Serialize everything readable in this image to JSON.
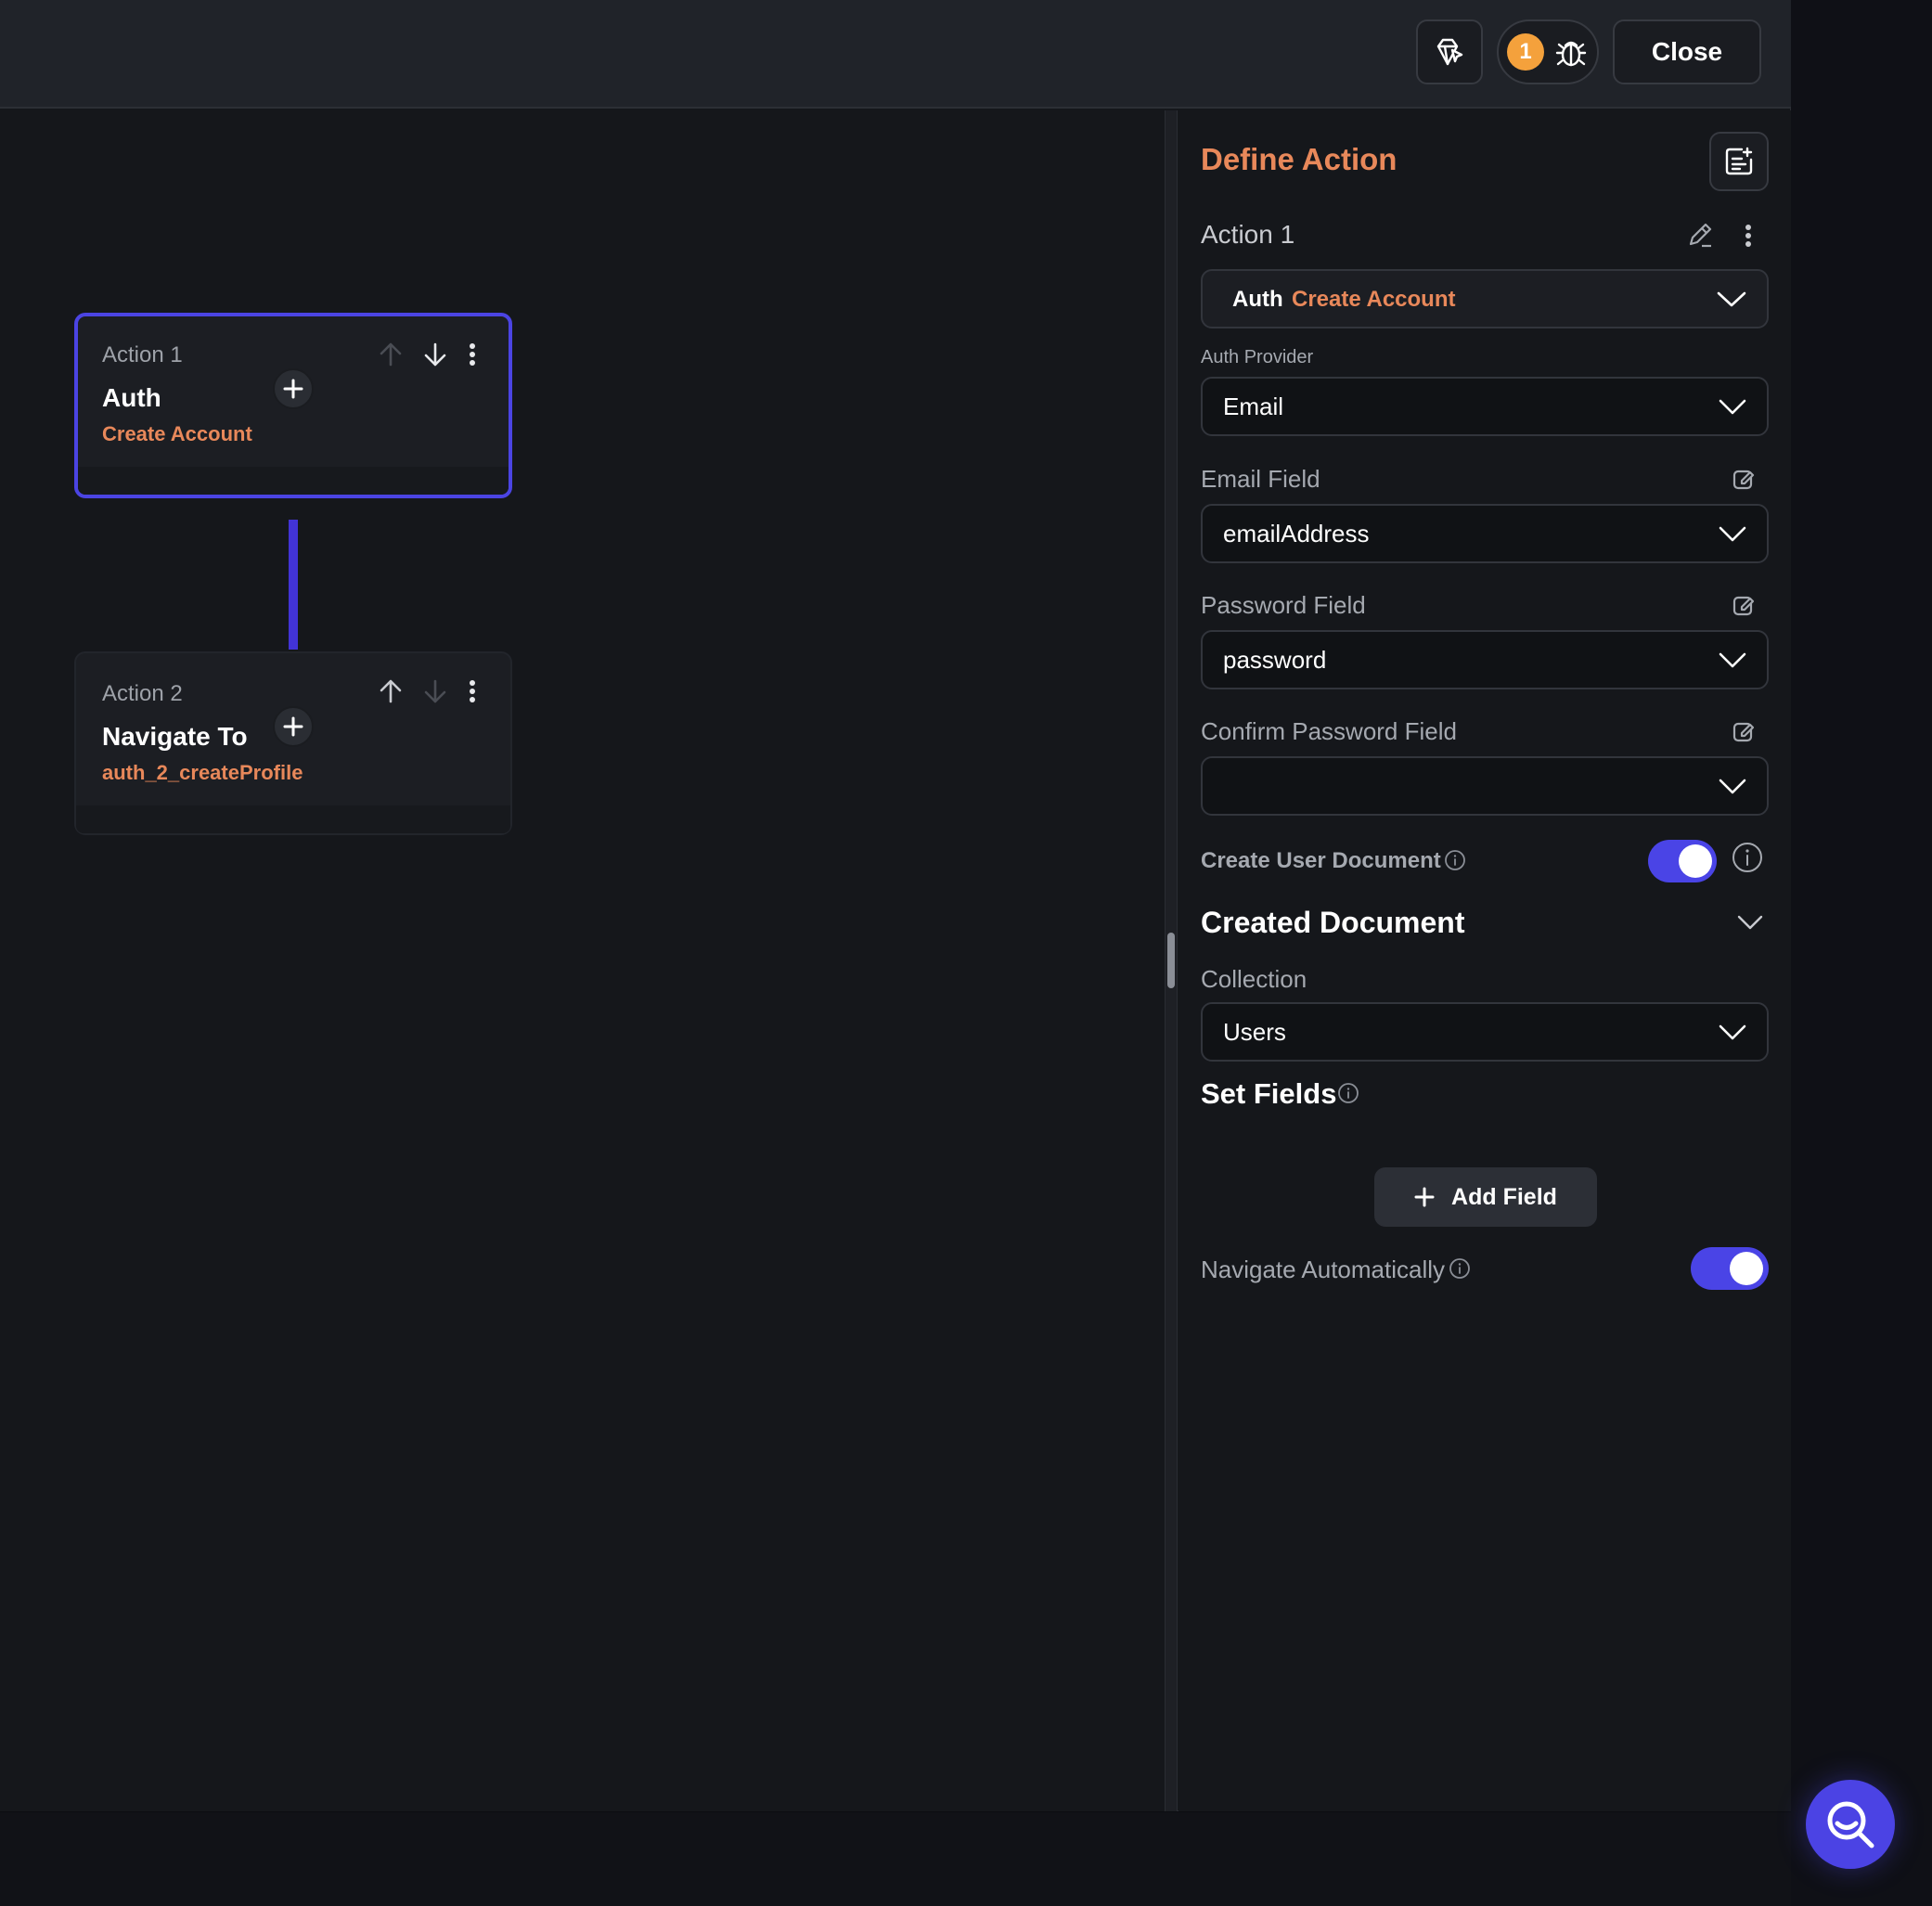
{
  "topbar": {
    "badge_count": "1",
    "close_label": "Close"
  },
  "canvas": {
    "actions": [
      {
        "header": "Action 1",
        "title": "Auth",
        "subtitle": "Create Account"
      },
      {
        "header": "Action 2",
        "title": "Navigate To",
        "subtitle": "auth_2_createProfile"
      }
    ]
  },
  "panel": {
    "title": "Define Action",
    "action_name": "Action 1",
    "action_type": {
      "category": "Auth",
      "name": "Create Account"
    },
    "auth_provider": {
      "label": "Auth Provider",
      "value": "Email"
    },
    "email_field": {
      "label": "Email Field",
      "value": "emailAddress"
    },
    "password_field": {
      "label": "Password Field",
      "value": "password"
    },
    "confirm_password_field": {
      "label": "Confirm Password Field",
      "value": ""
    },
    "create_user_document": {
      "label": "Create User Document",
      "on": true
    },
    "created_document": {
      "title": "Created Document",
      "collection_label": "Collection",
      "collection_value": "Users"
    },
    "set_fields": {
      "title": "Set Fields",
      "add_label": "Add Field"
    },
    "navigate_automatically": {
      "label": "Navigate Automatically",
      "on": true
    }
  },
  "colors": {
    "accent": "#4b44e3",
    "orange": "#e8885a",
    "badge": "#f4a13c",
    "background": "#15171b"
  }
}
